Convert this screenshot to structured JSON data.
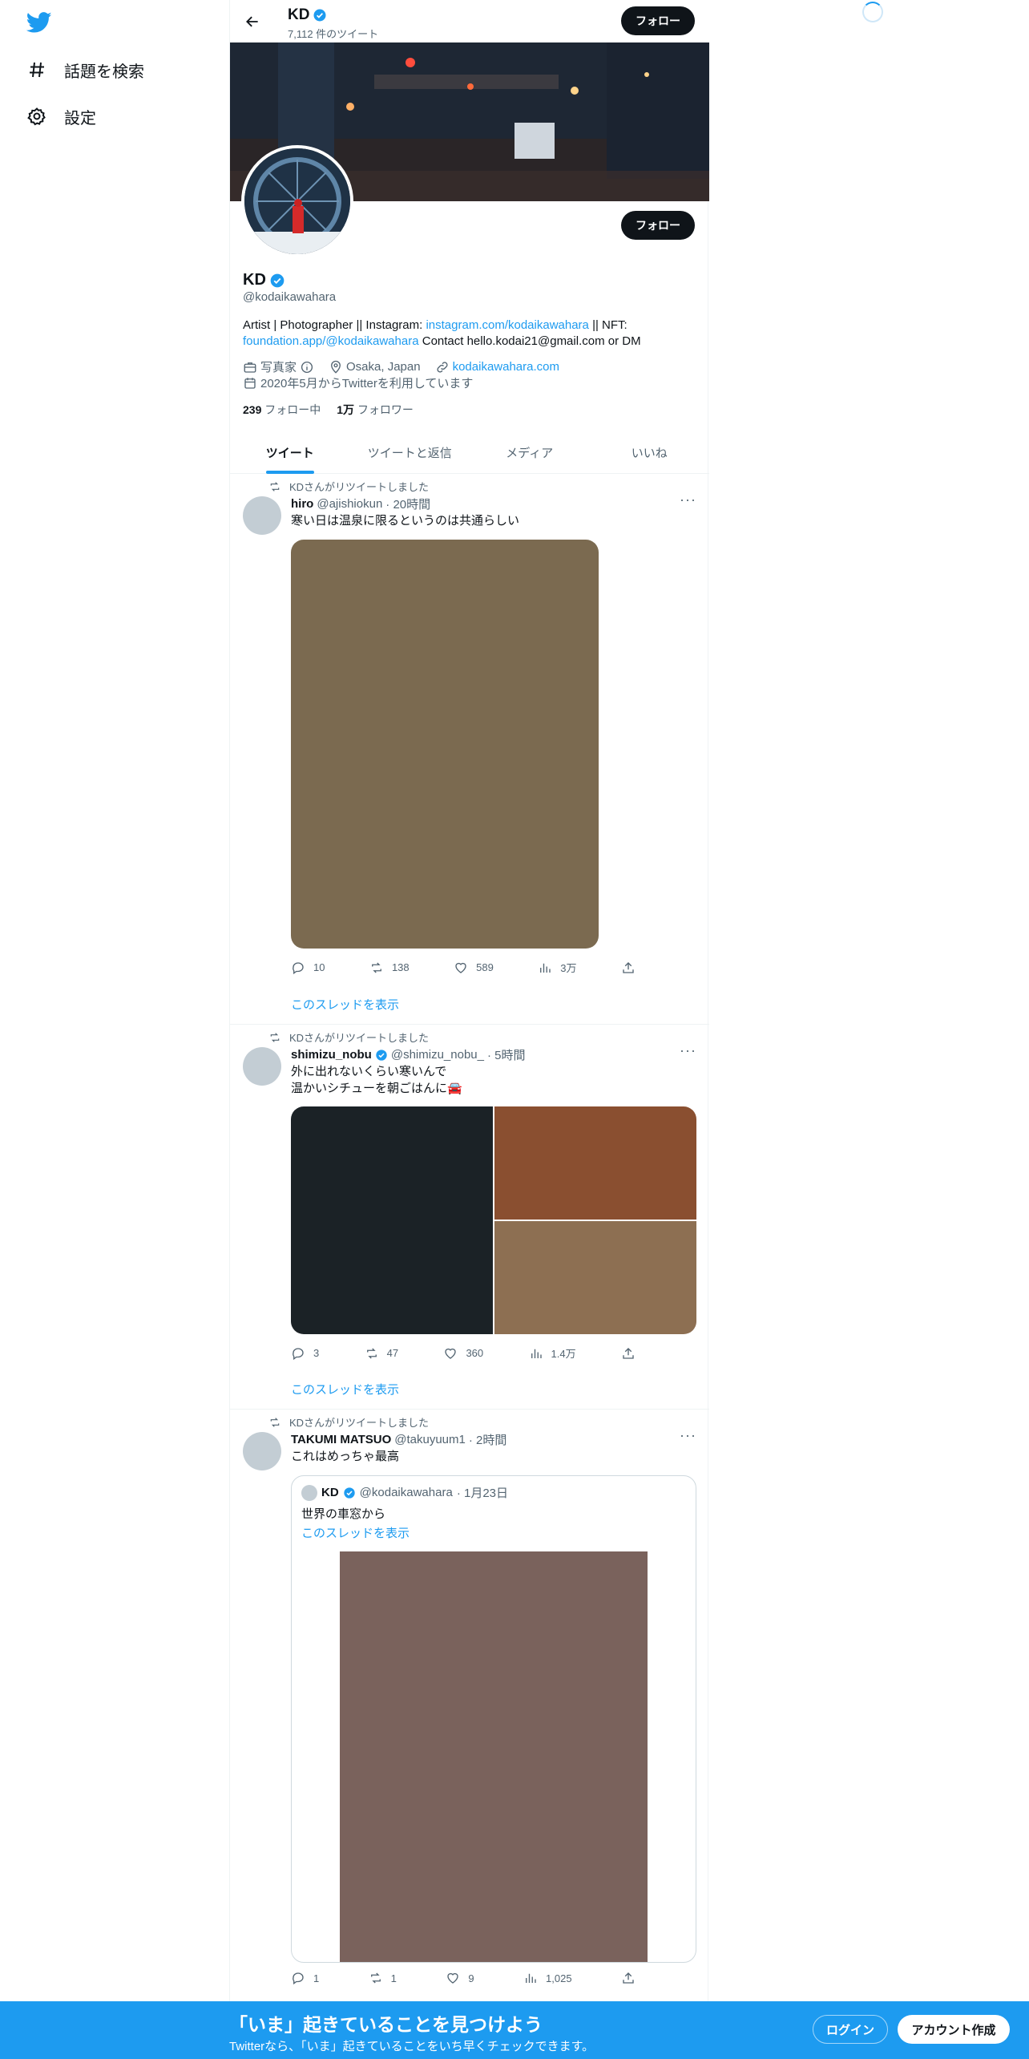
{
  "nav": {
    "explore_label": "話題を検索",
    "settings_label": "設定"
  },
  "header": {
    "name": "KD",
    "tweet_count": "7,112 件のツイート",
    "follow_label": "フォロー"
  },
  "profile": {
    "name": "KD",
    "handle": "@kodaikawahara",
    "follow_label": "フォロー",
    "bio_prefix": "Artist | Photographer || Instagram: ",
    "bio_link1": "instagram.com/kodaikawahara",
    "bio_mid": " || NFT: ",
    "bio_link2": "foundation.app/@kodaikawahara",
    "bio_suffix": " Contact hello.kodai21@gmail.com or DM",
    "category": "写真家",
    "location": "Osaka, Japan",
    "website": "kodaikawahara.com",
    "joined": "2020年5月からTwitterを利用しています",
    "following_count": "239",
    "following_label": "フォロー中",
    "followers_count": "1万",
    "followers_label": "フォロワー"
  },
  "tabs": [
    {
      "label": "ツイート"
    },
    {
      "label": "ツイートと返信"
    },
    {
      "label": "メディア"
    },
    {
      "label": "いいね"
    }
  ],
  "tweets": [
    {
      "retweet_label": "KDさんがリツイートしました",
      "name": "hiro",
      "handle": "@ajishiokun",
      "time": "· 20時間",
      "text": "寒い日は温泉に限るというのは共通らしい",
      "replies": "10",
      "retweets": "138",
      "likes": "589",
      "views": "3万",
      "thread_label": "このスレッドを表示",
      "media_colors": [
        "#7b6a50"
      ]
    },
    {
      "retweet_label": "KDさんがリツイートしました",
      "name": "shimizu_nobu",
      "handle": "@shimizu_nobu_",
      "time": "· 5時間",
      "text": "外に出れないくらい寒いんで\n温かいシチューを朝ごはんに🚘",
      "replies": "3",
      "retweets": "47",
      "likes": "360",
      "views": "1.4万",
      "thread_label": "このスレッドを表示",
      "media_colors": [
        "#1b2226",
        "#8a4f30",
        "#8d6f52"
      ]
    },
    {
      "retweet_label": "KDさんがリツイートしました",
      "name": "TAKUMI MATSUO",
      "handle": "@takuyuum1",
      "time": "· 2時間",
      "text": "これはめっちゃ最高",
      "replies": "1",
      "retweets": "1",
      "likes": "9",
      "views": "1,025",
      "quote": {
        "name": "KD",
        "handle": "@kodaikawahara",
        "time": "· 1月23日",
        "text": "世界の車窓から",
        "thread_label": "このスレッドを表示",
        "media_color": "#7a625c"
      }
    }
  ],
  "bottom_bar": {
    "title": "「いま」起きていることを見つけよう",
    "subtitle": "Twitterなら、「いま」起きていることをいち早くチェックできます。",
    "login_label": "ログイン",
    "signup_label": "アカウント作成"
  },
  "colors": {
    "accent": "#1d9bf0",
    "text": "#0f1419",
    "secondary": "#536471"
  }
}
